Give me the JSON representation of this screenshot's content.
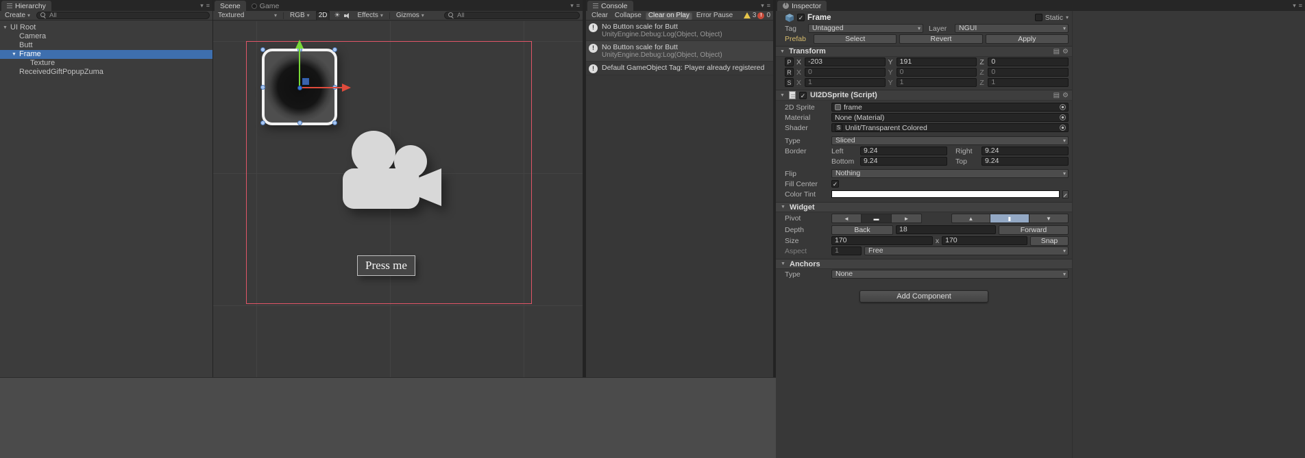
{
  "colors": {
    "selection_blue": "#3e6fae",
    "prefab_label": "#d8bd6e",
    "widget_outline_pink": "#e25668",
    "gizmo_green": "#79d838",
    "gizmo_red": "#e04b3c",
    "gizmo_blue": "#3b79d9",
    "color_tint_swatch": "#ffffff"
  },
  "icons": {
    "foldout_open": "▼",
    "dropdown": "▾",
    "check": "✓",
    "menu": "≡",
    "gear": "⚙",
    "book": "▤",
    "sun": "☀",
    "pivot_left": "◄",
    "pivot_hbar": "▬",
    "pivot_right": "►",
    "pivot_up": "▲",
    "pivot_vbar": "▮",
    "pivot_down": "▼"
  },
  "hierarchy": {
    "tab": "Hierarchy",
    "create_label": "Create",
    "search_filter": "All",
    "items": [
      {
        "label": "UI Root"
      },
      {
        "label": "Camera"
      },
      {
        "label": "Butt"
      },
      {
        "label": "Frame"
      },
      {
        "label": "Texture"
      },
      {
        "label": "ReceivedGiftPopupZuma"
      }
    ]
  },
  "scene": {
    "tab_scene": "Scene",
    "tab_game": "Game",
    "shading": "Textured",
    "color_mode": "RGB",
    "mode_2d": "2D",
    "effects": "Effects",
    "gizmos": "Gizmos",
    "search_filter": "All",
    "button_label": "Press me"
  },
  "console": {
    "tab": "Console",
    "clear": "Clear",
    "collapse": "Collapse",
    "clear_on_play": "Clear on Play",
    "error_pause": "Error Pause",
    "warning_count": "3",
    "error_count": "0",
    "entries": [
      {
        "message": "No Button scale for Butt",
        "trace": "UnityEngine.Debug:Log(Object, Object)"
      },
      {
        "message": "No Button scale for Butt",
        "trace": "UnityEngine.Debug:Log(Object, Object)"
      },
      {
        "message": "Default GameObject Tag: Player already registered",
        "trace": ""
      }
    ]
  },
  "inspector": {
    "tab": "Inspector",
    "name": "Frame",
    "static_label": "Static",
    "tag_label": "Tag",
    "tag_value": "Untagged",
    "layer_label": "Layer",
    "layer_value": "NGUI",
    "prefab_label": "Prefab",
    "prefab_select": "Select",
    "prefab_revert": "Revert",
    "prefab_apply": "Apply",
    "transform": {
      "title": "Transform",
      "axes": {
        "x": "X",
        "y": "Y",
        "z": "Z"
      },
      "rows": [
        {
          "key": "P",
          "x": "-203",
          "y": "191",
          "z": "0"
        },
        {
          "key": "R",
          "x": "0",
          "y": "0",
          "z": "0"
        },
        {
          "key": "S",
          "x": "1",
          "y": "1",
          "z": "1"
        }
      ]
    },
    "sprite": {
      "title": "UI2DSprite (Script)",
      "sprite_label": "2D Sprite",
      "sprite_value": "frame",
      "material_label": "Material",
      "material_value": "None (Material)",
      "shader_label": "Shader",
      "shader_badge": "S",
      "shader_value": "Unlit/Transparent Colored",
      "type_label": "Type",
      "type_value": "Sliced",
      "border_label": "Border",
      "border_left_label": "Left",
      "border_left": "9.24",
      "border_right_label": "Right",
      "border_right": "9.24",
      "border_bottom_label": "Bottom",
      "border_bottom": "9.24",
      "border_top_label": "Top",
      "border_top": "9.24",
      "flip_label": "Flip",
      "flip_value": "Nothing",
      "fill_center_label": "Fill Center",
      "color_tint_label": "Color Tint"
    },
    "widget": {
      "title": "Widget",
      "pivot_label": "Pivot",
      "depth_label": "Depth",
      "back_label": "Back",
      "depth_value": "18",
      "forward_label": "Forward",
      "size_label": "Size",
      "size_width": "170",
      "size_sep": "x",
      "size_height": "170",
      "snap_label": "Snap",
      "aspect_label": "Aspect",
      "aspect_value": "1",
      "aspect_mode": "Free"
    },
    "anchors": {
      "title": "Anchors",
      "type_label": "Type",
      "type_value": "None"
    },
    "add_component": "Add Component"
  }
}
